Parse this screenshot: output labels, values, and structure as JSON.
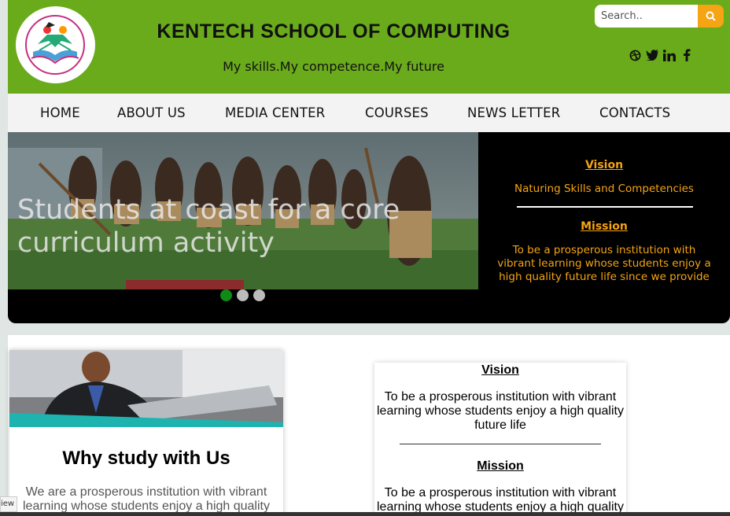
{
  "header": {
    "title": "KENTECH SCHOOL OF COMPUTING",
    "tagline": "My skills.My competence.My future",
    "logo_icon": "open-book-students-logo",
    "colors": {
      "header_bg": "#6aab1c",
      "accent": "#f5a414"
    }
  },
  "search": {
    "placeholder": "Search..",
    "button_icon": "search-icon"
  },
  "social": [
    "dribbble-icon",
    "twitter-icon",
    "linkedin-icon",
    "facebook-icon"
  ],
  "nav": {
    "items": [
      {
        "label": "HOME"
      },
      {
        "label": "ABOUT US"
      },
      {
        "label": "MEDIA CENTER"
      },
      {
        "label": "COURSES"
      },
      {
        "label": "NEWS LETTER"
      },
      {
        "label": "CONTACTS"
      }
    ]
  },
  "hero": {
    "caption": "Students at coast for a core curriculum activity",
    "dots": 3,
    "active_dot": 0
  },
  "hero_panel": {
    "vision_heading": "Vision",
    "vision_text": "Naturing Skills and Competencies",
    "mission_heading": "Mission",
    "mission_text": "To be a prosperous institution with vibrant learning whose students enjoy a high quality future life since we provide"
  },
  "why": {
    "title": "Why study with Us",
    "text": "We are a prosperous institution with vibrant learning whose students enjoy a high quality"
  },
  "info_card": {
    "vision_heading": "Vision",
    "vision_text": "To be a prosperous institution with vibrant learning whose students enjoy a high quality future life",
    "mission_heading": "Mission",
    "mission_text": "To be a prosperous institution with vibrant learning whose students enjoy a high quality"
  },
  "view_tab": "iew"
}
